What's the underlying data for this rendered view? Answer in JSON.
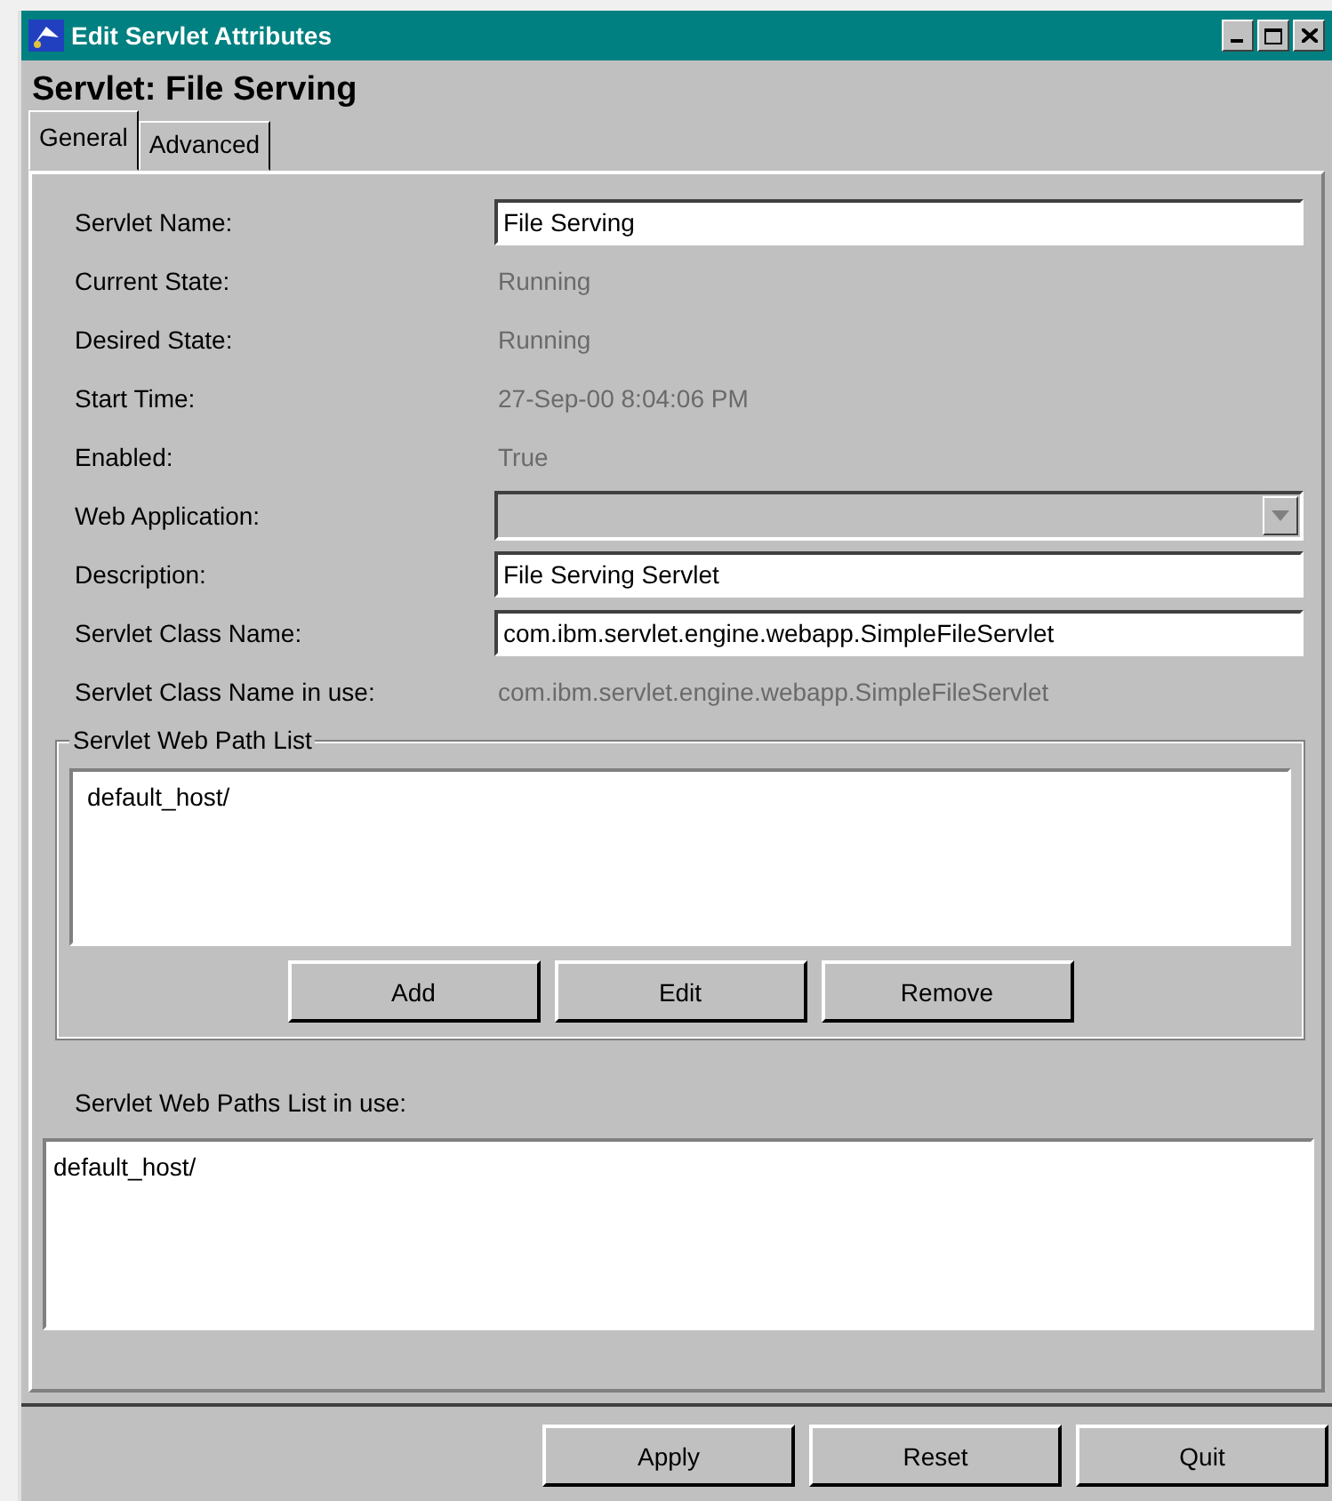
{
  "window": {
    "title": "Edit Servlet Attributes"
  },
  "heading": "Servlet: File Serving",
  "tabs": [
    {
      "label": "General",
      "selected": true
    },
    {
      "label": "Advanced",
      "selected": false
    }
  ],
  "fields": [
    {
      "kind": "input",
      "label": "Servlet Name:",
      "value": "File Serving"
    },
    {
      "kind": "readonly",
      "label": "Current State:",
      "value": "Running"
    },
    {
      "kind": "readonly",
      "label": "Desired State:",
      "value": "Running"
    },
    {
      "kind": "readonly",
      "label": "Start Time:",
      "value": "27-Sep-00 8:04:06 PM"
    },
    {
      "kind": "readonly",
      "label": "Enabled:",
      "value": "True"
    },
    {
      "kind": "dropdown",
      "label": "Web Application:",
      "disabled": true
    },
    {
      "kind": "input",
      "label": "Description:",
      "value": "File Serving Servlet"
    },
    {
      "kind": "input",
      "label": "Servlet Class Name:",
      "value": "com.ibm.servlet.engine.webapp.SimpleFileServlet"
    },
    {
      "kind": "readonly",
      "label": "Servlet Class Name in use:",
      "value": "com.ibm.servlet.engine.webapp.SimpleFileServlet"
    }
  ],
  "path_list": {
    "title": "Servlet Web Path List",
    "items": [
      "default_host/"
    ],
    "buttons": [
      "Add",
      "Edit",
      "Remove"
    ]
  },
  "paths_in_use": {
    "label": "Servlet Web Paths List in use:",
    "items": [
      "default_host/"
    ]
  },
  "buttons": [
    "Apply",
    "Reset",
    "Quit"
  ]
}
